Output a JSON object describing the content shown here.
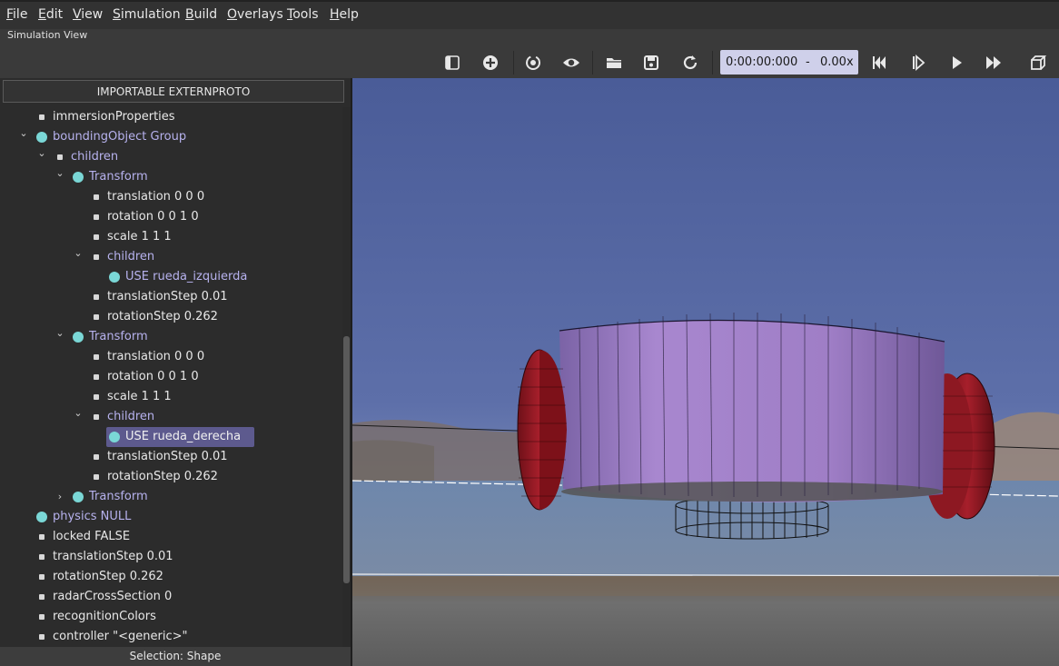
{
  "menu": [
    {
      "label": "File",
      "accel": "F",
      "rest": "ile"
    },
    {
      "label": "Edit",
      "accel": "E",
      "rest": "dit"
    },
    {
      "label": "View",
      "accel": "V",
      "rest": "iew"
    },
    {
      "label": "Simulation",
      "accel": "S",
      "rest": "imulation"
    },
    {
      "label": "Build",
      "accel": "B",
      "rest": "uild"
    },
    {
      "label": "Overlays",
      "accel": "O",
      "rest": "verlays"
    },
    {
      "label": "Tools",
      "accel": "T",
      "rest": "ools"
    },
    {
      "label": "Help",
      "accel": "H",
      "rest": "elp"
    }
  ],
  "panel_title": "Simulation View",
  "toolbar": {
    "icons": [
      "panel-toggle-icon",
      "add-node-icon",
      "reset-viewpoint-icon",
      "eye-icon",
      "open-folder-icon",
      "save-icon",
      "reload-icon",
      "step-back-icon",
      "step-icon",
      "play-icon",
      "fast-forward-icon",
      "cube-view-icon"
    ],
    "time": "0:00:00:000",
    "dash": "-",
    "speed": "0.00x"
  },
  "tree": {
    "extern_button": "IMPORTABLE EXTERNPROTO",
    "rows": [
      {
        "label": "immersionProperties",
        "kind": "field",
        "depth": 0,
        "chev": ""
      },
      {
        "label": "boundingObject Group",
        "kind": "node",
        "depth": 0,
        "chev": "v"
      },
      {
        "label": "children",
        "kind": "node-field",
        "depth": 1,
        "chev": "v"
      },
      {
        "label": "Transform",
        "kind": "node",
        "depth": 2,
        "chev": "v"
      },
      {
        "label": "translation 0 0 0",
        "kind": "field",
        "depth": 3,
        "chev": ""
      },
      {
        "label": "rotation 0 0 1 0",
        "kind": "field",
        "depth": 3,
        "chev": ""
      },
      {
        "label": "scale 1 1 1",
        "kind": "field",
        "depth": 3,
        "chev": ""
      },
      {
        "label": "children",
        "kind": "node-field",
        "depth": 3,
        "chev": "v"
      },
      {
        "label": "USE rueda_izquierda",
        "kind": "node",
        "depth": 4,
        "chev": ""
      },
      {
        "label": "translationStep 0.01",
        "kind": "field",
        "depth": 3,
        "chev": ""
      },
      {
        "label": "rotationStep 0.262",
        "kind": "field",
        "depth": 3,
        "chev": ""
      },
      {
        "label": "Transform",
        "kind": "node",
        "depth": 2,
        "chev": "v"
      },
      {
        "label": "translation 0 0 0",
        "kind": "field",
        "depth": 3,
        "chev": ""
      },
      {
        "label": "rotation 0 0 1 0",
        "kind": "field",
        "depth": 3,
        "chev": ""
      },
      {
        "label": "scale 1 1 1",
        "kind": "field",
        "depth": 3,
        "chev": ""
      },
      {
        "label": "children",
        "kind": "node-field",
        "depth": 3,
        "chev": "v"
      },
      {
        "label": "USE rueda_derecha",
        "kind": "node",
        "depth": 4,
        "chev": "",
        "selected": true
      },
      {
        "label": "translationStep 0.01",
        "kind": "field",
        "depth": 3,
        "chev": ""
      },
      {
        "label": "rotationStep 0.262",
        "kind": "field",
        "depth": 3,
        "chev": ""
      },
      {
        "label": "Transform",
        "kind": "node",
        "depth": 2,
        "chev": ">"
      },
      {
        "label": "physics NULL",
        "kind": "node",
        "depth": 0,
        "chev": ""
      },
      {
        "label": "locked FALSE",
        "kind": "field",
        "depth": 0,
        "chev": ""
      },
      {
        "label": "translationStep 0.01",
        "kind": "field",
        "depth": 0,
        "chev": ""
      },
      {
        "label": "rotationStep 0.262",
        "kind": "field",
        "depth": 0,
        "chev": ""
      },
      {
        "label": "radarCrossSection 0",
        "kind": "field",
        "depth": 0,
        "chev": ""
      },
      {
        "label": "recognitionColors",
        "kind": "field",
        "depth": 0,
        "chev": ""
      },
      {
        "label": "controller \"<generic>\"",
        "kind": "field",
        "depth": 0,
        "chev": ""
      }
    ]
  },
  "status": "Selection: Shape",
  "colors": {
    "node_label": "#b7b2ee",
    "node_dot": "#7ad7d6",
    "selection": "#5d5a8e",
    "robot_body": "#9c7cc0",
    "wheel": "#9e1c26",
    "time_box": "#cfd0ea"
  }
}
